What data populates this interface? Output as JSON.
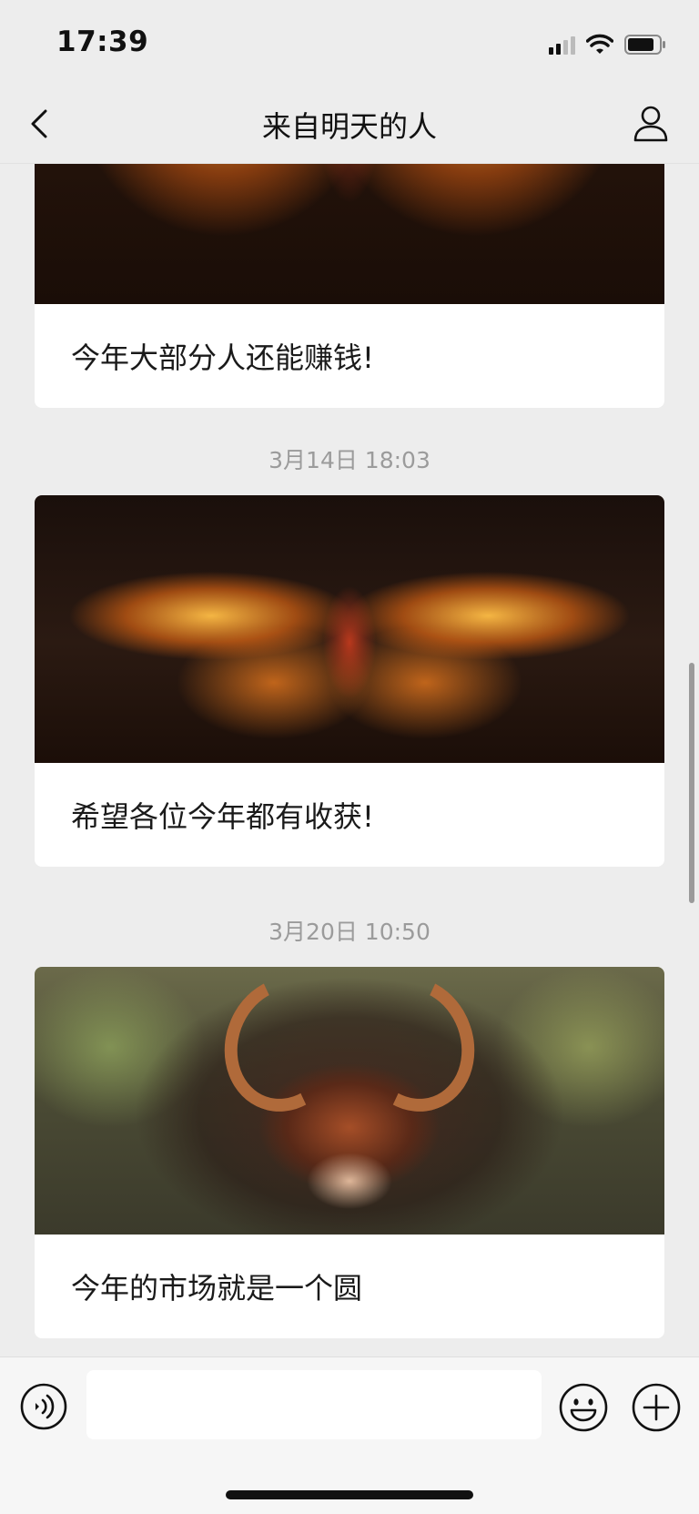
{
  "status_bar": {
    "time": "17:39"
  },
  "nav": {
    "title": "来自明天的人"
  },
  "messages": [
    {
      "caption": "今年大部分人还能赚钱!"
    },
    {
      "timestamp": "3月14日 18:03",
      "caption": "希望各位今年都有收获!"
    },
    {
      "timestamp": "3月20日 10:50",
      "caption": "今年的市场就是一个圆"
    }
  ],
  "input": {
    "value": ""
  },
  "icons": {
    "back": "chevron-left-icon",
    "profile": "person-icon",
    "voice": "voice-icon",
    "emoji": "emoji-icon",
    "plus": "plus-icon"
  }
}
